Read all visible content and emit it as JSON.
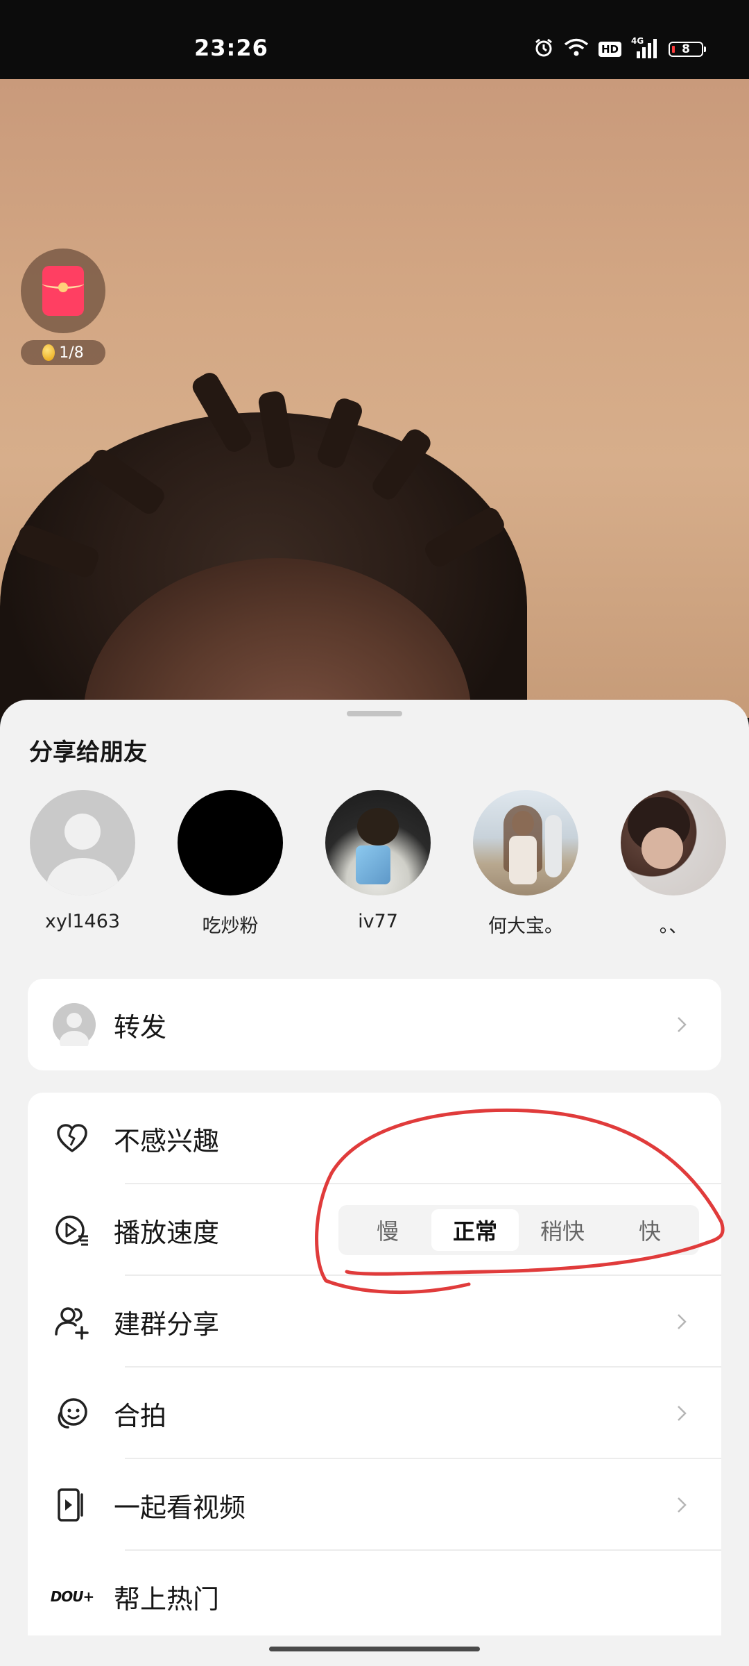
{
  "status_bar": {
    "time": "23:26",
    "icons": [
      "alarm-icon",
      "wifi-icon",
      "hd-icon",
      "signal-4g-icon",
      "battery-icon"
    ],
    "hd_label": "HD",
    "network_label": "4G",
    "battery_level": "8",
    "battery_color": "#ff3b3b"
  },
  "video": {
    "red_packet_counter": "1/8"
  },
  "share_sheet": {
    "title": "分享给朋友",
    "friends": [
      {
        "name": "xyl1463",
        "avatar": "default-avatar"
      },
      {
        "name": "吃炒粉",
        "avatar": "black-avatar"
      },
      {
        "name": "iv77",
        "avatar": "photo-avatar"
      },
      {
        "name": "何大宝。",
        "avatar": "photo-avatar"
      },
      {
        "name": "。、",
        "avatar": "photo-avatar"
      }
    ],
    "forward": {
      "label": "转发"
    },
    "actions": {
      "not_interested": "不感兴趣",
      "playback_speed": "播放速度",
      "speed_options": [
        "慢",
        "正常",
        "稍快",
        "快"
      ],
      "speed_selected": "正常",
      "group_share": "建群分享",
      "duet": "合拍",
      "watch_together": "一起看视频",
      "dou_plus": "帮上热门",
      "dou_plus_logo": "DOU+"
    }
  },
  "colors": {
    "annotation_stroke": "#e03b3b",
    "sheet_bg": "#f2f2f2",
    "card_bg": "#ffffff"
  }
}
